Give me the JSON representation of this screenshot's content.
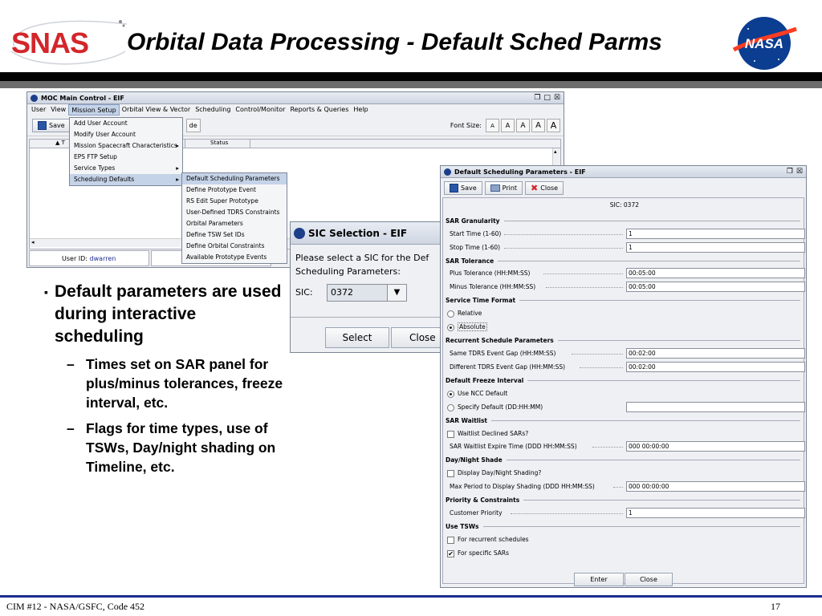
{
  "header": {
    "logo_text": "SNAS",
    "title": "Orbital Data Processing - Default Sched Parms",
    "agency_logo_text": "NASA"
  },
  "moc_window": {
    "title": "MOC Main Control - EIF",
    "menus": [
      "User",
      "View",
      "Mission Setup",
      "Orbital View & Vector",
      "Scheduling",
      "Control/Monitor",
      "Reports & Queries",
      "Help"
    ],
    "save_label": "Save",
    "de_fragment": "de",
    "font_size_label": "Font Size:",
    "font_buttons": [
      "A",
      "A",
      "A",
      "A",
      "A"
    ],
    "col_t": "▲ T",
    "col_status": "Status",
    "user_id_label": "User ID:",
    "user_id_value": "dwarren"
  },
  "mission_setup_menu": {
    "items": [
      "Add User Account",
      "Modify User Account",
      "Mission Spacecraft Characteristics",
      "EPS FTP Setup",
      "Service Types",
      "Scheduling Defaults"
    ]
  },
  "scheduling_defaults_menu": {
    "items": [
      "Default Scheduling Parameters",
      "Define Prototype Event",
      "RS Edit Super Prototype",
      "User-Defined TDRS Constraints",
      "Orbital Parameters",
      "Define TSW Set IDs",
      "Define Orbital Constraints",
      "Available Prototype Events"
    ]
  },
  "sic_window": {
    "title": "SIC Selection - EIF",
    "prompt_line1": "Please select a SIC for the Def",
    "prompt_line2": "Scheduling Parameters:",
    "sic_label": "SIC:",
    "sic_value": "0372",
    "select_label": "Select",
    "close_label": "Close"
  },
  "dsp_window": {
    "title": "Default Scheduling Parameters - EIF",
    "save_label": "Save",
    "print_label": "Print",
    "close_label": "Close",
    "sic_text": "SIC: 0372",
    "sar_granularity": "SAR Granularity",
    "start_time_label": "Start Time (1-60)",
    "start_time_value": "1",
    "stop_time_label": "Stop Time (1-60)",
    "stop_time_value": "1",
    "sar_tolerance": "SAR Tolerance",
    "plus_tol_label": "Plus Tolerance (HH:MM:SS)",
    "plus_tol_value": "00:05:00",
    "minus_tol_label": "Minus Tolerance (HH:MM:SS)",
    "minus_tol_value": "00:05:00",
    "service_time_format": "Service Time Format",
    "relative_label": "Relative",
    "absolute_label": "Absolute",
    "time_format_selected": "Absolute",
    "recurrent_params": "Recurrent Schedule Parameters",
    "same_gap_label": "Same TDRS Event Gap (HH:MM:SS)",
    "same_gap_value": "00:02:00",
    "diff_gap_label": "Different TDRS Event Gap (HH:MM:SS)",
    "diff_gap_value": "00:02:00",
    "freeze_interval": "Default Freeze Interval",
    "use_ncc_label": "Use NCC Default",
    "specify_label": "Specify Default (DD:HH:MM)",
    "freeze_selected": "Use NCC Default",
    "specify_value": "",
    "sar_waitlist": "SAR Waitlist",
    "waitlist_declined_label": "Waitlist Declined SARs?",
    "waitlist_declined_checked": false,
    "waitlist_expire_label": "SAR Waitlist Expire Time (DDD HH:MM:SS)",
    "waitlist_expire_value": "000 00:00:00",
    "day_night": "Day/Night Shade",
    "display_shading_label": "Display Day/Night Shading?",
    "display_shading_checked": false,
    "max_period_label": "Max Period to Display Shading (DDD HH:MM:SS)",
    "max_period_value": "000 00:00:00",
    "priority_constraints": "Priority & Constraints",
    "customer_priority_label": "Customer Priority",
    "customer_priority_value": "1",
    "use_tsws": "Use TSWs",
    "for_recurrent_label": "For recurrent schedules",
    "for_recurrent_checked": false,
    "for_specific_label": "For specific SARs",
    "for_specific_checked": true,
    "enter_label": "Enter",
    "close_bottom_label": "Close"
  },
  "bullets": {
    "main": "Default parameters are used during interactive scheduling",
    "sub1": "Times set on SAR panel for plus/minus tolerances, freeze interval, etc.",
    "sub2": "Flags for time types, use of TSWs, Day/night shading on Timeline, etc.",
    "marker_main": "▪",
    "marker_sub": "–"
  },
  "footer": {
    "left": "CIM #12 - NASA/GSFC, Code 452",
    "page": "17"
  },
  "colors": {
    "snas_red": "#d3262b",
    "nasa_blue": "#0b3d91",
    "footer_line": "#1c2d8f"
  }
}
